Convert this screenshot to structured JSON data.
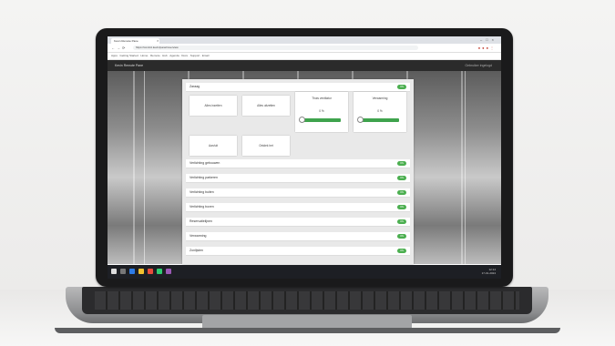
{
  "browser": {
    "tab_title": "Kevin Remote Pane",
    "url": "https://control.kevin/panel/overview",
    "bookmarks": "Apps · Getting Started · Home · Remote · Hub · Agenda · Docs · Support · Email"
  },
  "app": {
    "title": "Kevin Remote Pane",
    "user": "Gebruiker ingelogd"
  },
  "panel": {
    "section_title": "Zaraag",
    "buttons": [
      "Alles inzetten",
      "Alles uitzetten",
      "Aan/uit",
      "Ontdek het"
    ],
    "cards": [
      {
        "title": "Thuis ventilator",
        "value": "0 %",
        "level": 0.0
      },
      {
        "title": "Verwarming",
        "value": "0 %",
        "level": 0.0
      }
    ],
    "rows": [
      "Verlichting gebouwen",
      "Verlichting parkeren",
      "Verlichting buiten",
      "Verlichting boven",
      "Reservatielijnen",
      "Verwarming",
      "Zonlijsten"
    ],
    "pill_label": "ON"
  },
  "taskbar": {
    "time": "12:14",
    "date": "17-01-2024"
  },
  "colors": {
    "accent": "#4caf50",
    "header_bg": "#2b2b2b"
  }
}
